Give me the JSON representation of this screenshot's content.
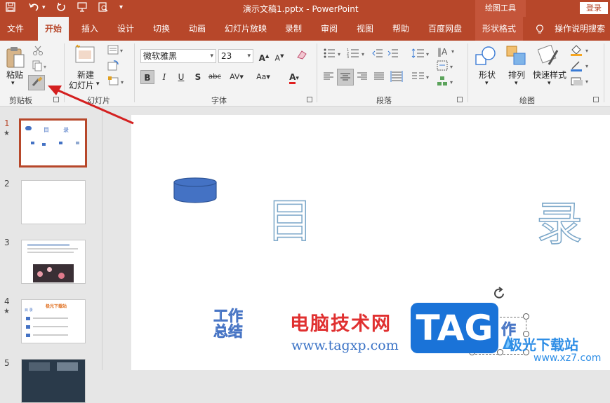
{
  "titlebar": {
    "doc_title": "演示文稿1.pptx  -  PowerPoint",
    "context_label": "绘图工具",
    "login": "登录"
  },
  "tabs": [
    "文件",
    "开始",
    "插入",
    "设计",
    "切换",
    "动画",
    "幻灯片放映",
    "录制",
    "审阅",
    "视图",
    "帮助",
    "百度网盘",
    "形状格式"
  ],
  "active_tab": "开始",
  "tell_me": "操作说明搜索",
  "ribbon": {
    "clipboard": {
      "paste": "粘贴",
      "group": "剪贴板"
    },
    "slides": {
      "new_slide_line1": "新建",
      "new_slide_line2": "幻灯片",
      "group": "幻灯片"
    },
    "font": {
      "font_name": "微软雅黑",
      "font_size": "23",
      "group": "字体"
    },
    "paragraph": {
      "group": "段落"
    },
    "drawing": {
      "shape": "形状",
      "arrange": "排列",
      "quick_styles": "快速样式",
      "group": "绘图"
    }
  },
  "thumbnails": [
    {
      "num": "1",
      "star": "★",
      "title_left": "目",
      "title_right": "录"
    },
    {
      "num": "2",
      "star": ""
    },
    {
      "num": "3",
      "star": ""
    },
    {
      "num": "4",
      "star": "★",
      "heading": "极光下载站",
      "label": "目 录"
    },
    {
      "num": "5",
      "star": ""
    }
  ],
  "slide": {
    "char_left": "目",
    "char_right": "录",
    "small_text": "工作\n总结",
    "small_text_right": "作"
  },
  "watermark": {
    "red_text": "电脑技术网",
    "url": "www.tagxp.com",
    "tag": "TAG",
    "site": "极光下载站",
    "site_url": "www.xz7.com"
  },
  "colors": {
    "accent": "#b7472a",
    "shape_blue": "#4472c4",
    "outline_text": "#7aa6c8"
  }
}
